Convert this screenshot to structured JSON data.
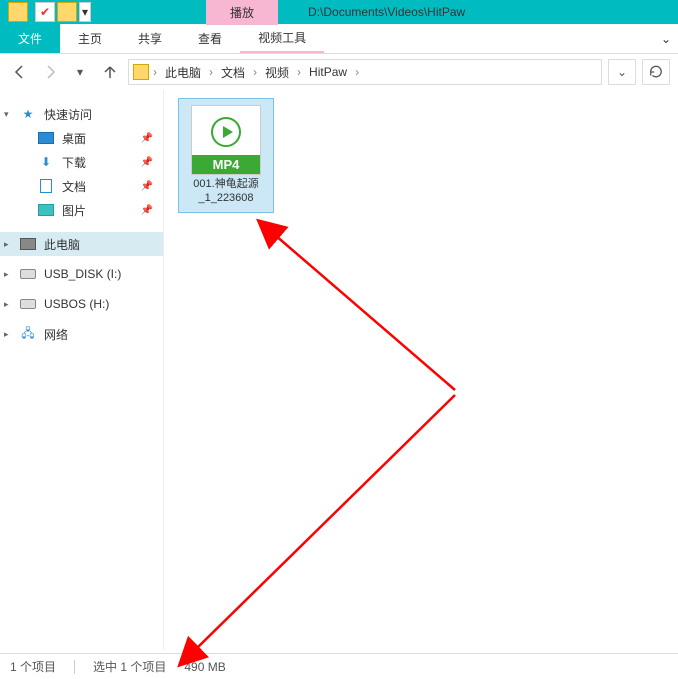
{
  "titlebar": {
    "context_tab": "播放",
    "path": "D:\\Documents\\Videos\\HitPaw"
  },
  "ribbon": {
    "file": "文件",
    "home": "主页",
    "share": "共享",
    "view": "查看",
    "video_tools": "视频工具"
  },
  "breadcrumb": {
    "items": [
      "此电脑",
      "文档",
      "视频",
      "HitPaw"
    ]
  },
  "nav": {
    "quick_access": "快速访问",
    "desktop": "桌面",
    "downloads": "下载",
    "documents": "文档",
    "pictures": "图片",
    "this_pc": "此电脑",
    "usb_disk": "USB_DISK (I:)",
    "usbos": "USBOS (H:)",
    "network": "网络"
  },
  "file": {
    "badge": "MP4",
    "name_line1": "001.神龟起源",
    "name_line2": "_1_223608"
  },
  "status": {
    "count": "1 个项目",
    "selected": "选中 1 个项目",
    "size": "490 MB"
  }
}
